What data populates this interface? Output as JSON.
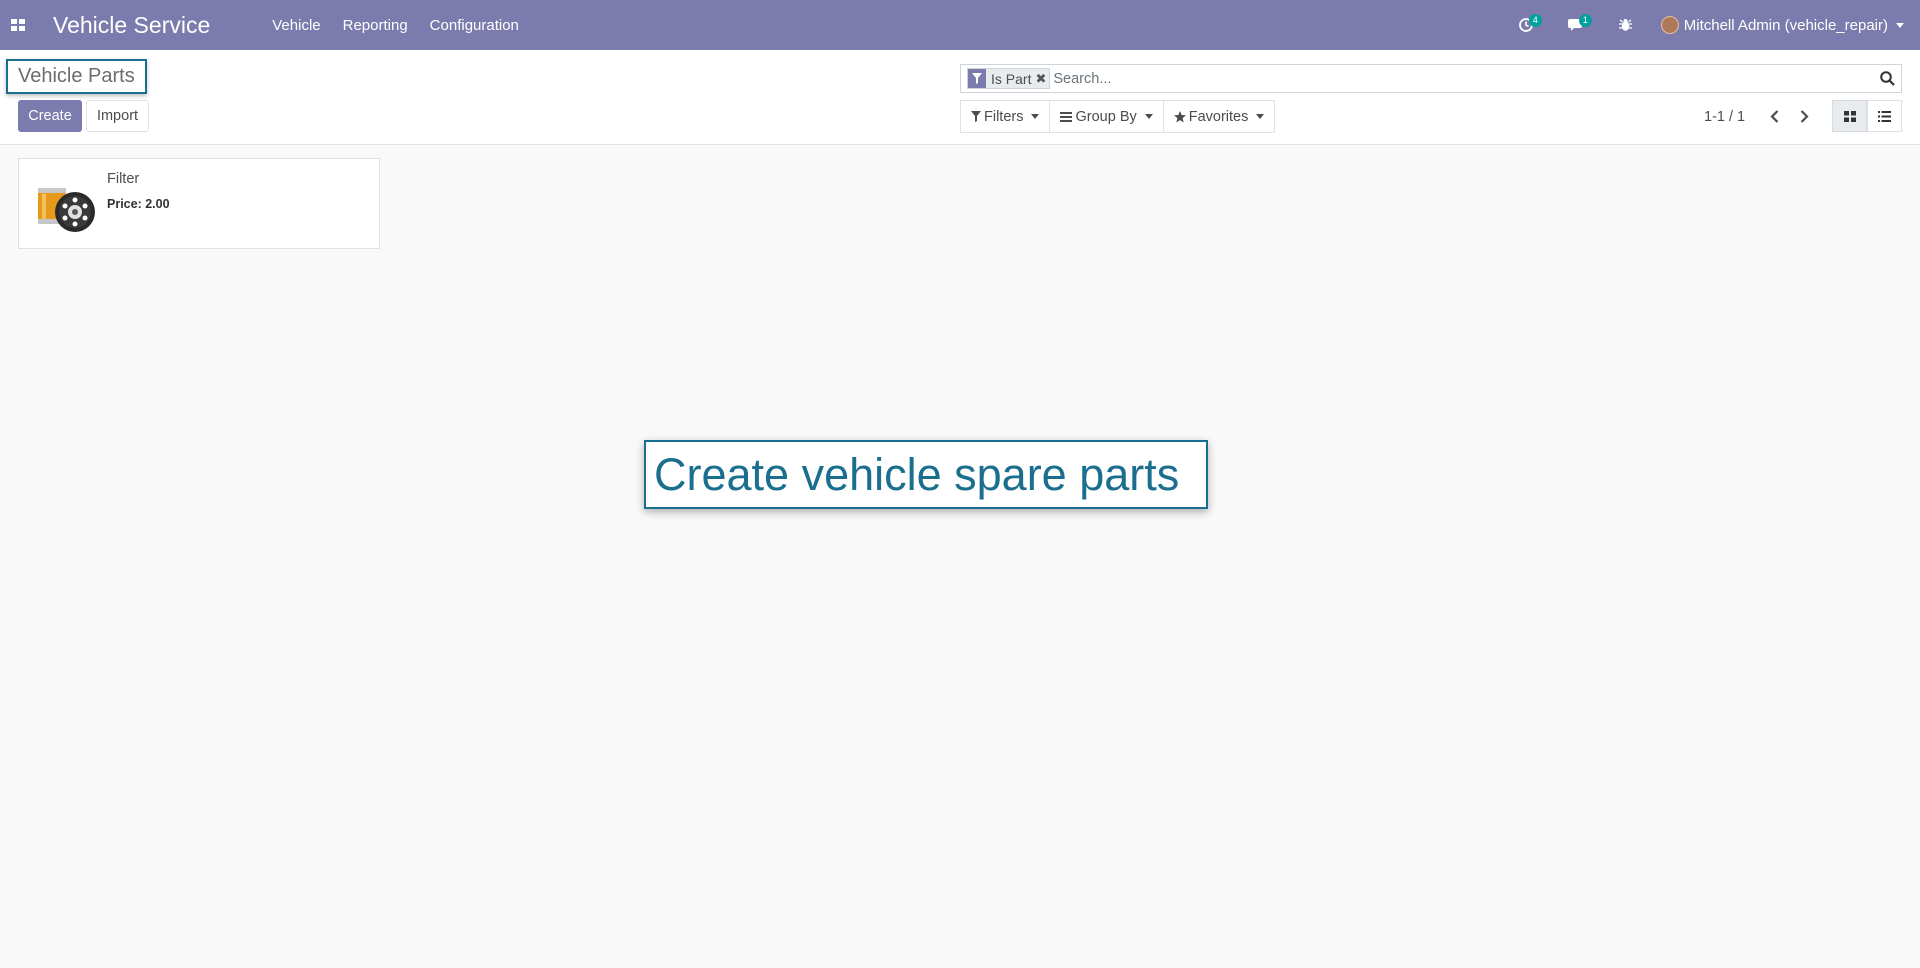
{
  "navbar": {
    "app_name": "Vehicle Service",
    "menu": [
      "Vehicle",
      "Reporting",
      "Configuration"
    ],
    "activity_count": "4",
    "message_count": "1",
    "user_name": "Mitchell Admin (vehicle_repair)"
  },
  "control_panel": {
    "breadcrumb": "Vehicle Parts",
    "create_label": "Create",
    "import_label": "Import",
    "search": {
      "facet": "Is Part",
      "placeholder": "Search..."
    },
    "filters_label": "Filters",
    "group_by_label": "Group By",
    "favorites_label": "Favorites",
    "pager": "1-1 / 1"
  },
  "records": [
    {
      "name": "Filter",
      "price": "Price: 2.00"
    }
  ],
  "tour_tip": "Create vehicle spare parts",
  "colors": {
    "brand": "#7c7bad",
    "accent": "#1b6f8e",
    "badge": "#00a09d"
  }
}
